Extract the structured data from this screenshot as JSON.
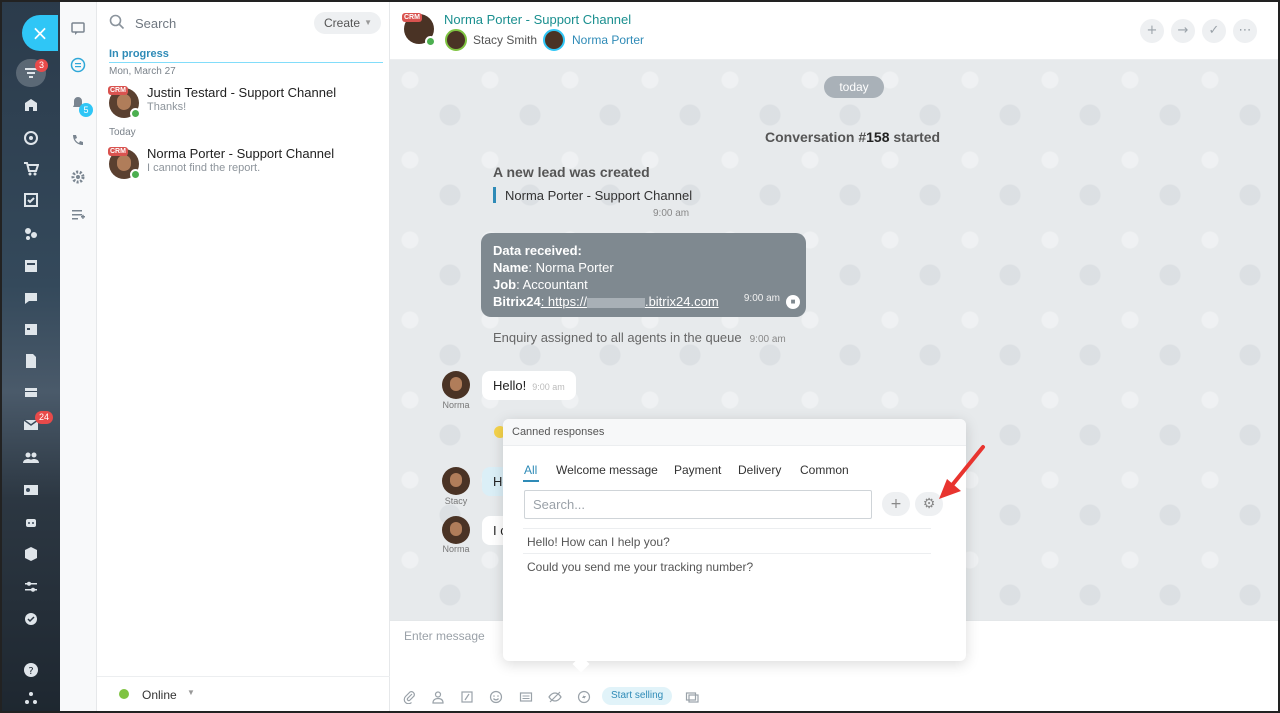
{
  "left_nav": {
    "close_glyph": "×",
    "feed_badge": "3",
    "mail_badge": "24",
    "icons": [
      "feed-icon",
      "company-icon",
      "target-icon",
      "cart-icon",
      "tasks-icon",
      "graph-icon",
      "page-icon",
      "chat-icon",
      "calendar-icon",
      "document-icon",
      "drive-icon",
      "mail-icon",
      "users-icon",
      "contact-card-icon",
      "robot-icon",
      "box-icon",
      "settings-sliders-icon",
      "check-circle-icon",
      "help-icon",
      "org-icon"
    ]
  },
  "icon_column": {
    "badge": "5",
    "icons": [
      "chat-bubble-icon",
      "open-lines-icon",
      "notifications-icon",
      "phone-icon",
      "gear-icon",
      "list-add-icon"
    ]
  },
  "chat_list": {
    "search_placeholder": "Search",
    "create_label": "Create",
    "section_label": "In progress",
    "groups": [
      {
        "date": "Mon, March 27",
        "name": "Justin Testard - Support Channel",
        "preview": "Thanks!",
        "tag": "CRM"
      },
      {
        "date": "Today",
        "name": "Norma Porter - Support Channel",
        "preview": "I cannot find the report.",
        "tag": "CRM"
      }
    ],
    "status_label": "Online"
  },
  "conversation": {
    "tag": "CRM",
    "title": "Norma Porter - Support Channel",
    "members": [
      "Stacy Smith",
      "Norma Porter"
    ],
    "header_actions": [
      "+",
      "→",
      "✓",
      "⋯"
    ],
    "date_pill": "today",
    "started_prefix": "Conversation #",
    "started_number": "158",
    "started_suffix": " started",
    "lead_title": "A new lead was created",
    "lead_link": "Norma Porter - Support Channel",
    "lead_time": "9:00 am",
    "data_card": {
      "heading": "Data received:",
      "name_label": "Name",
      "name_value": ": Norma Porter",
      "job_label": "Job",
      "job_value": ": Accountant",
      "site_label": "Bitrix24",
      "site_prefix": ": https://",
      "site_suffix": ".bitrix24.com",
      "time": "9:00 am"
    },
    "enquiry_text": "Enquiry assigned to all agents in the queue",
    "enquiry_time": "9:00 am",
    "messages": [
      {
        "author": "Norma",
        "text": "Hello!",
        "time": "9:00 am"
      },
      {
        "author": "Stacy",
        "text": "He"
      },
      {
        "author": "Norma",
        "text": "I c"
      }
    ],
    "input_placeholder": "Enter message",
    "start_selling": "Start selling",
    "toolbar_icons": [
      "paperclip-icon",
      "user-icon",
      "form-icon",
      "smile-icon",
      "keyboard-icon",
      "eye-off-icon",
      "lightning-icon",
      "screen-icon"
    ]
  },
  "canned_popup": {
    "title": "Canned responses",
    "tabs": [
      "All",
      "Welcome message",
      "Payment",
      "Delivery",
      "Common"
    ],
    "search_placeholder": "Search...",
    "add_glyph": "+",
    "settings_glyph": "⚙",
    "responses": [
      "Hello! How can I help you?",
      "Could you send me your tracking number?"
    ]
  },
  "colors": {
    "accent": "#2fc6f6",
    "link": "#2f8bb7",
    "title_teal": "#1a8f8f",
    "annotation_arrow": "#e8342f"
  }
}
